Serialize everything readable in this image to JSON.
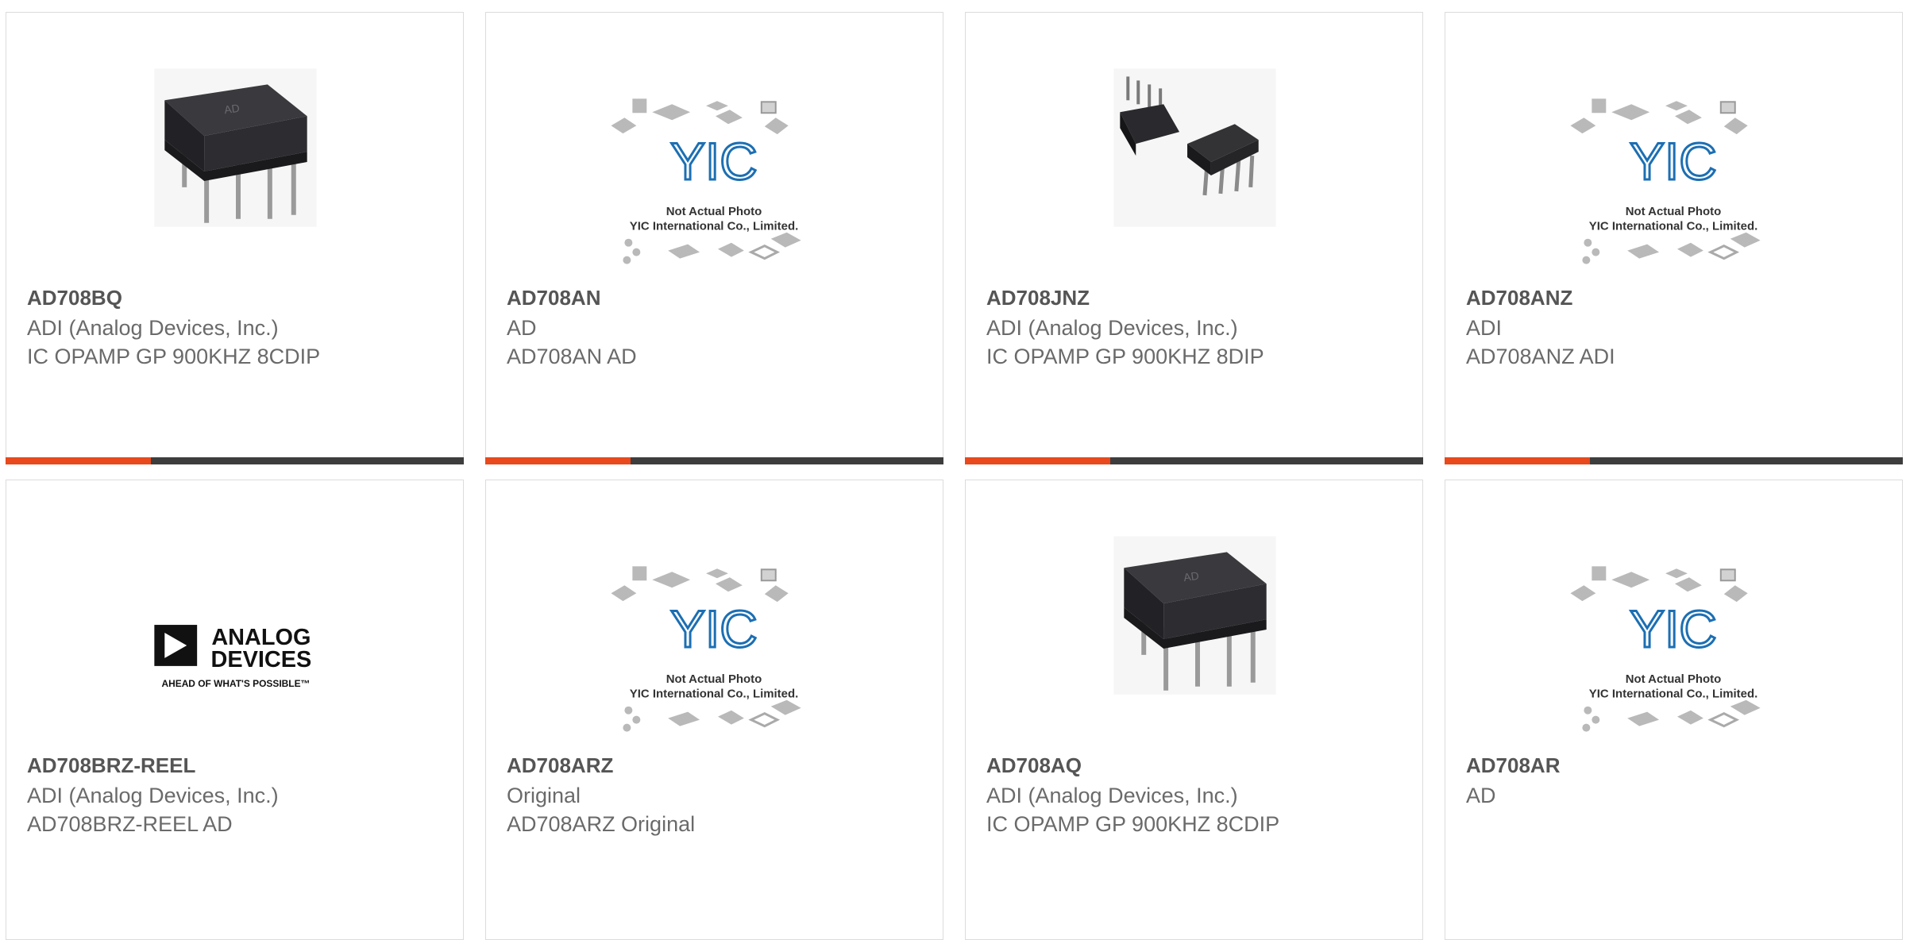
{
  "colors": {
    "accent": "#e8491d",
    "bar": "#3d3d3d",
    "title": "#555555",
    "text": "#6a6a6a"
  },
  "products": [
    {
      "part": "AD708BQ",
      "manufacturer": "ADI (Analog Devices, Inc.)",
      "description": "IC OPAMP GP 900KHZ 8CDIP",
      "image": "dip-chip-photo"
    },
    {
      "part": "AD708AN",
      "manufacturer": "AD",
      "description": "AD708AN AD",
      "image": "yic-placeholder"
    },
    {
      "part": "AD708JNZ",
      "manufacturer": "ADI (Analog Devices, Inc.)",
      "description": "IC OPAMP GP 900KHZ 8DIP",
      "image": "dual-dip-photo"
    },
    {
      "part": "AD708ANZ",
      "manufacturer": "ADI",
      "description": "AD708ANZ ADI",
      "image": "yic-placeholder"
    },
    {
      "part": "AD708BRZ-REEL",
      "manufacturer": "ADI (Analog Devices, Inc.)",
      "description": "AD708BRZ-REEL AD",
      "image": "analog-devices-logo"
    },
    {
      "part": "AD708ARZ",
      "manufacturer": "Original",
      "description": "AD708ARZ Original",
      "image": "yic-placeholder"
    },
    {
      "part": "AD708AQ",
      "manufacturer": "ADI (Analog Devices, Inc.)",
      "description": "IC OPAMP GP 900KHZ 8CDIP",
      "image": "dip-chip-photo"
    },
    {
      "part": "AD708AR",
      "manufacturer": "AD",
      "description": "",
      "image": "yic-placeholder"
    }
  ],
  "placeholder": {
    "line1": "Not Actual Photo",
    "line2": "YIC International Co., Limited."
  },
  "adi_logo": {
    "line1": "ANALOG",
    "line2": "DEVICES",
    "tagline": "AHEAD OF WHAT'S POSSIBLE™"
  },
  "chip_mark": "AD"
}
